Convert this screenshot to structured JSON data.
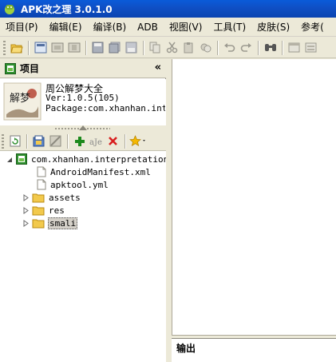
{
  "window": {
    "title": "APK改之理 3.0.1.0"
  },
  "menu": [
    {
      "label": "项目(P)"
    },
    {
      "label": "编辑(E)"
    },
    {
      "label": "编译(B)"
    },
    {
      "label": "ADB"
    },
    {
      "label": "视图(V)"
    },
    {
      "label": "工具(T)"
    },
    {
      "label": "皮肤(S)"
    },
    {
      "label": "参考("
    }
  ],
  "toolbar": {
    "icons": [
      "open-folder-icon",
      "new-project-icon",
      "build-icon",
      "sign-icon",
      "save-icon",
      "save-all-icon",
      "save-as-icon",
      "copy-icon",
      "cut-icon",
      "paste-icon",
      "replace-icon",
      "undo-icon",
      "redo-icon",
      "find-icon",
      "window-icon",
      "settings-icon"
    ]
  },
  "project_panel": {
    "title": "项目",
    "collapse_label": "«",
    "app": {
      "name": "周公解梦大全",
      "version": "Ver:1.0.5(105)",
      "package": "Package:com.xhanhan.interpretationdream"
    },
    "logo_text": "解梦"
  },
  "project_toolbar": {
    "icons": [
      "refresh-icon",
      "open-icon",
      "properties-icon",
      "add-icon",
      "rename-icon",
      "delete-icon",
      "favorite-icon"
    ]
  },
  "tree": {
    "root": "com.xhanhan.interpretationdream",
    "items": [
      {
        "label": "AndroidManifest.xml",
        "type": "file"
      },
      {
        "label": "apktool.yml",
        "type": "file"
      },
      {
        "label": "assets",
        "type": "folder"
      },
      {
        "label": "res",
        "type": "folder"
      },
      {
        "label": "smali",
        "type": "folder",
        "selected": true
      }
    ]
  },
  "output": {
    "title": "输出"
  },
  "colors": {
    "title_bar": "#0a5bd9",
    "window_bg": "#ece9d8",
    "folder": "#f2c94c",
    "add_green": "#1d8a1d",
    "delete_red": "#d81e1e"
  }
}
